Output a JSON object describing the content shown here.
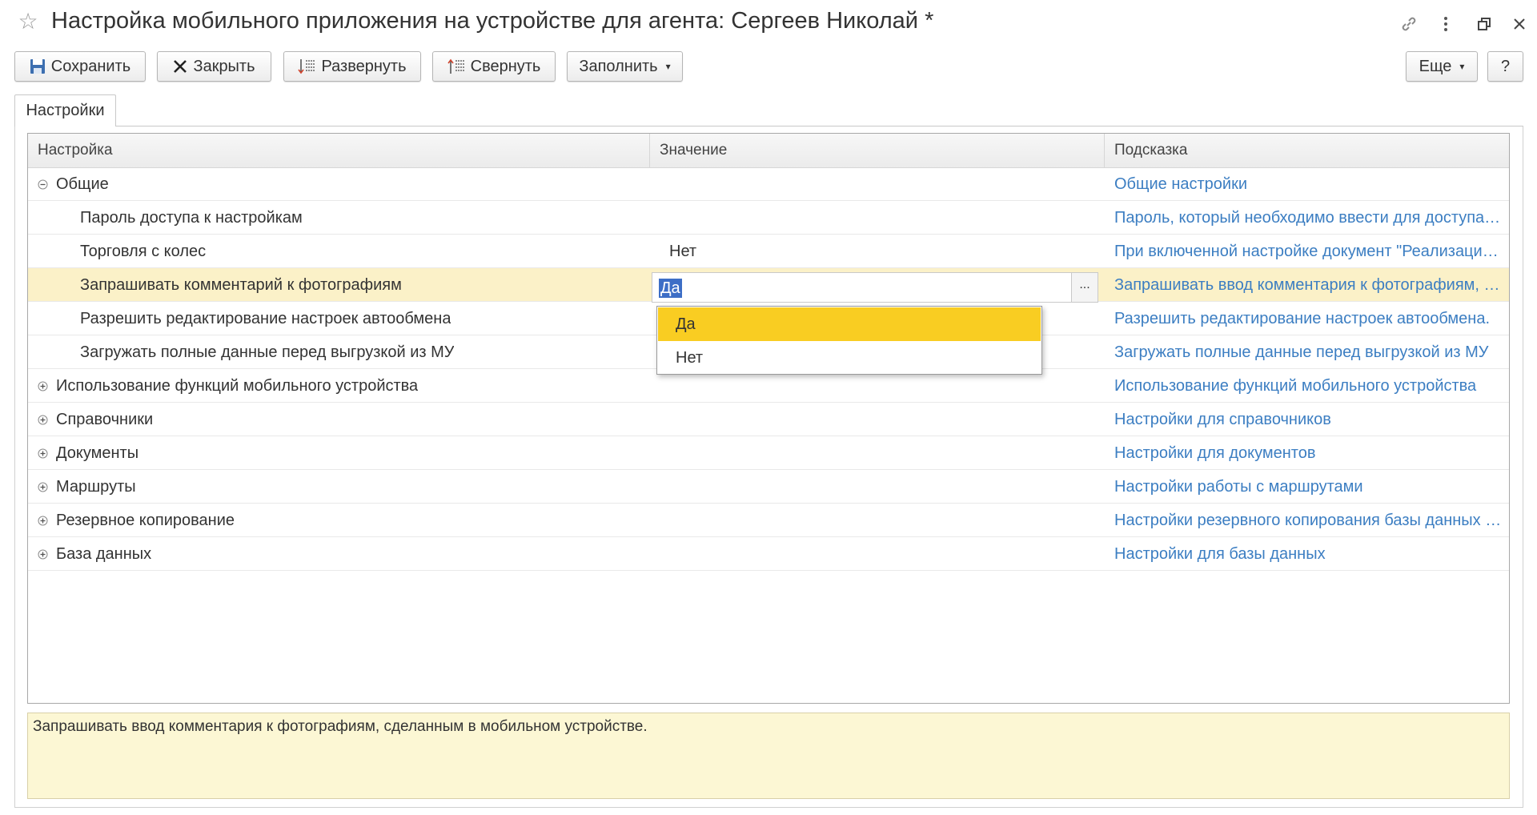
{
  "window": {
    "title": "Настройка мобильного приложения на устройстве для агента: Сергеев Николай *"
  },
  "toolbar": {
    "save_label": "Сохранить",
    "close_label": "Закрыть",
    "expand_label": "Развернуть",
    "collapse_label": "Свернуть",
    "fill_label": "Заполнить",
    "more_label": "Еще",
    "help_label": "?"
  },
  "tabs": [
    {
      "label": "Настройки"
    }
  ],
  "grid": {
    "columns": [
      "Настройка",
      "Значение",
      "Подсказка"
    ],
    "rows": [
      {
        "name": "Общие",
        "value": "",
        "hint": "Общие настройки",
        "toggle": "minus"
      },
      {
        "name": "Пароль доступа к настройкам",
        "value": "",
        "hint": "Пароль, который необходимо ввести для доступа к настройкам",
        "toggle": "none"
      },
      {
        "name": "Торговля с колес",
        "value": "Нет",
        "hint": "При включенной настройке документ \"Реализация товаров\"",
        "toggle": "none"
      },
      {
        "name": "Запрашивать комментарий к фотографиям",
        "value": "Да",
        "hint": "Запрашивать ввод комментария к фотографиям, сделанным в мобильном устройстве",
        "toggle": "none",
        "selected": true
      },
      {
        "name": "Разрешить редактирование настроек автообмена",
        "value": "",
        "hint": "Разрешить редактирование настроек автообмена.",
        "toggle": "none"
      },
      {
        "name": "Загружать полные данные перед выгрузкой из МУ",
        "value": "",
        "hint": "Загружать полные данные перед выгрузкой из МУ",
        "toggle": "none"
      },
      {
        "name": "Использование функций мобильного устройства",
        "value": "",
        "hint": "Использование функций мобильного устройства",
        "toggle": "plus"
      },
      {
        "name": "Справочники",
        "value": "",
        "hint": "Настройки для справочников",
        "toggle": "plus"
      },
      {
        "name": "Документы",
        "value": "",
        "hint": "Настройки для документов",
        "toggle": "plus"
      },
      {
        "name": "Маршруты",
        "value": "",
        "hint": "Настройки работы с маршрутами",
        "toggle": "plus"
      },
      {
        "name": "Резервное копирование",
        "value": "",
        "hint": "Настройки резервного копирования базы данных мобильного устройства",
        "toggle": "plus"
      },
      {
        "name": "База данных",
        "value": "",
        "hint": "Настройки для базы данных",
        "toggle": "plus"
      }
    ]
  },
  "editor": {
    "value": "Да",
    "choice_button": "..."
  },
  "dropdown": {
    "options": [
      "Да",
      "Нет"
    ],
    "selected": "Да"
  },
  "info_text": "Запрашивать ввод комментария к фотографиям, сделанным в мобильном устройстве.",
  "colors": {
    "hint_link": "#3c7ec2",
    "selected_row": "#fbf1c8",
    "dropdown_active": "#f9cd22",
    "text_selection": "#3d6ec6",
    "info_background": "#fcf7d4"
  }
}
